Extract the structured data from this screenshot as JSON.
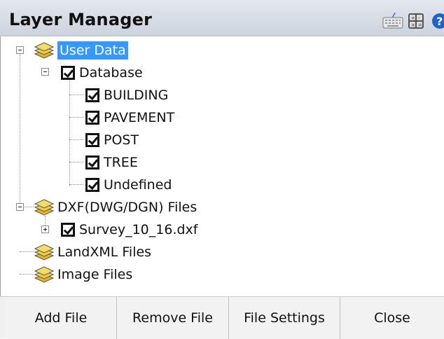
{
  "window": {
    "title": "Layer Manager"
  },
  "titlebar_icons": [
    "keyboard-icon",
    "calculator-icon",
    "help-icon"
  ],
  "tree": {
    "user_data": {
      "label": "User Data",
      "database": {
        "label": "Database",
        "layers": [
          "BUILDING",
          "PAVEMENT",
          "POST",
          "TREE",
          "Undefined"
        ]
      }
    },
    "dxf": {
      "label": "DXF(DWG/DGN) Files",
      "file": "Survey_10_16.dxf"
    },
    "landxml": {
      "label": "LandXML Files"
    },
    "images": {
      "label": "Image Files"
    }
  },
  "buttons": {
    "add": "Add File",
    "remove": "Remove File",
    "settings": "File Settings",
    "close": "Close"
  },
  "colors": {
    "selection": "#3399ff",
    "layer_icon": "#e6b422"
  }
}
